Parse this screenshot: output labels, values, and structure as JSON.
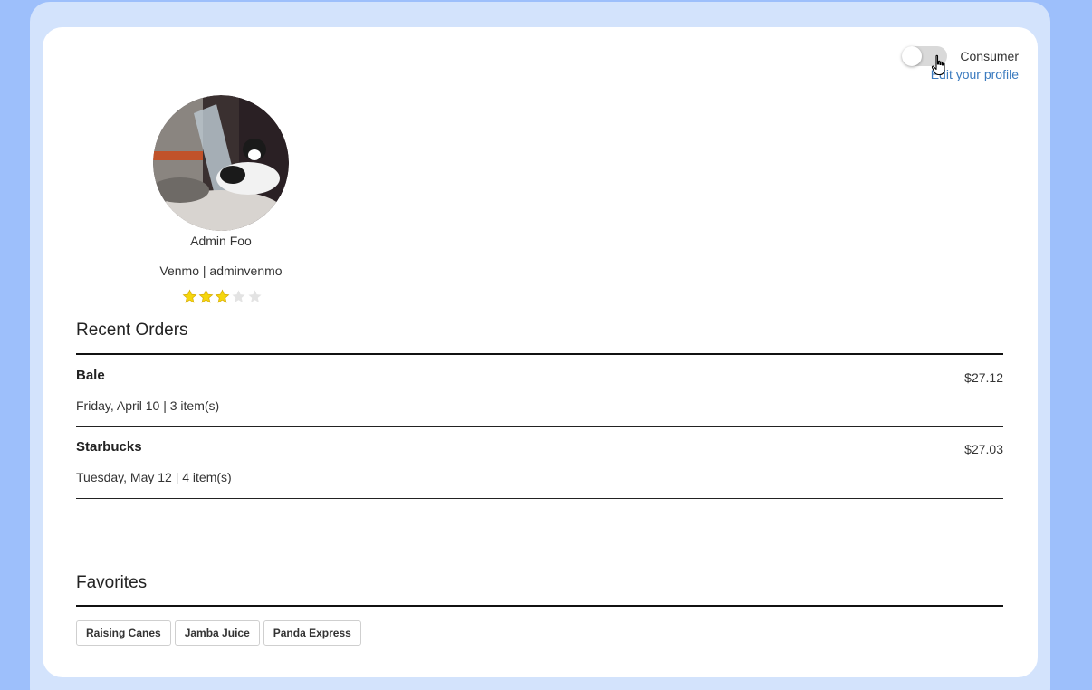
{
  "header": {
    "toggle_label": "Consumer",
    "toggle_on": false,
    "edit_link": "Edit your profile"
  },
  "profile": {
    "name": "Admin Foo",
    "venmo": "Venmo | adminvenmo",
    "rating": 3,
    "rating_max": 5,
    "star_color": "#f5d60c"
  },
  "recent_orders": {
    "title": "Recent Orders",
    "items": [
      {
        "name": "Bale",
        "price": "$27.12",
        "meta": "Friday, April 10 | 3 item(s)"
      },
      {
        "name": "Starbucks",
        "price": "$27.03",
        "meta": "Tuesday, May 12 | 4 item(s)"
      }
    ]
  },
  "favorites": {
    "title": "Favorites",
    "items": [
      "Raising Canes",
      "Jamba Juice",
      "Panda Express"
    ]
  },
  "colors": {
    "background": "#9dbffb",
    "frame": "#d3e3fc",
    "card": "#ffffff",
    "link": "#3b7bbf"
  }
}
